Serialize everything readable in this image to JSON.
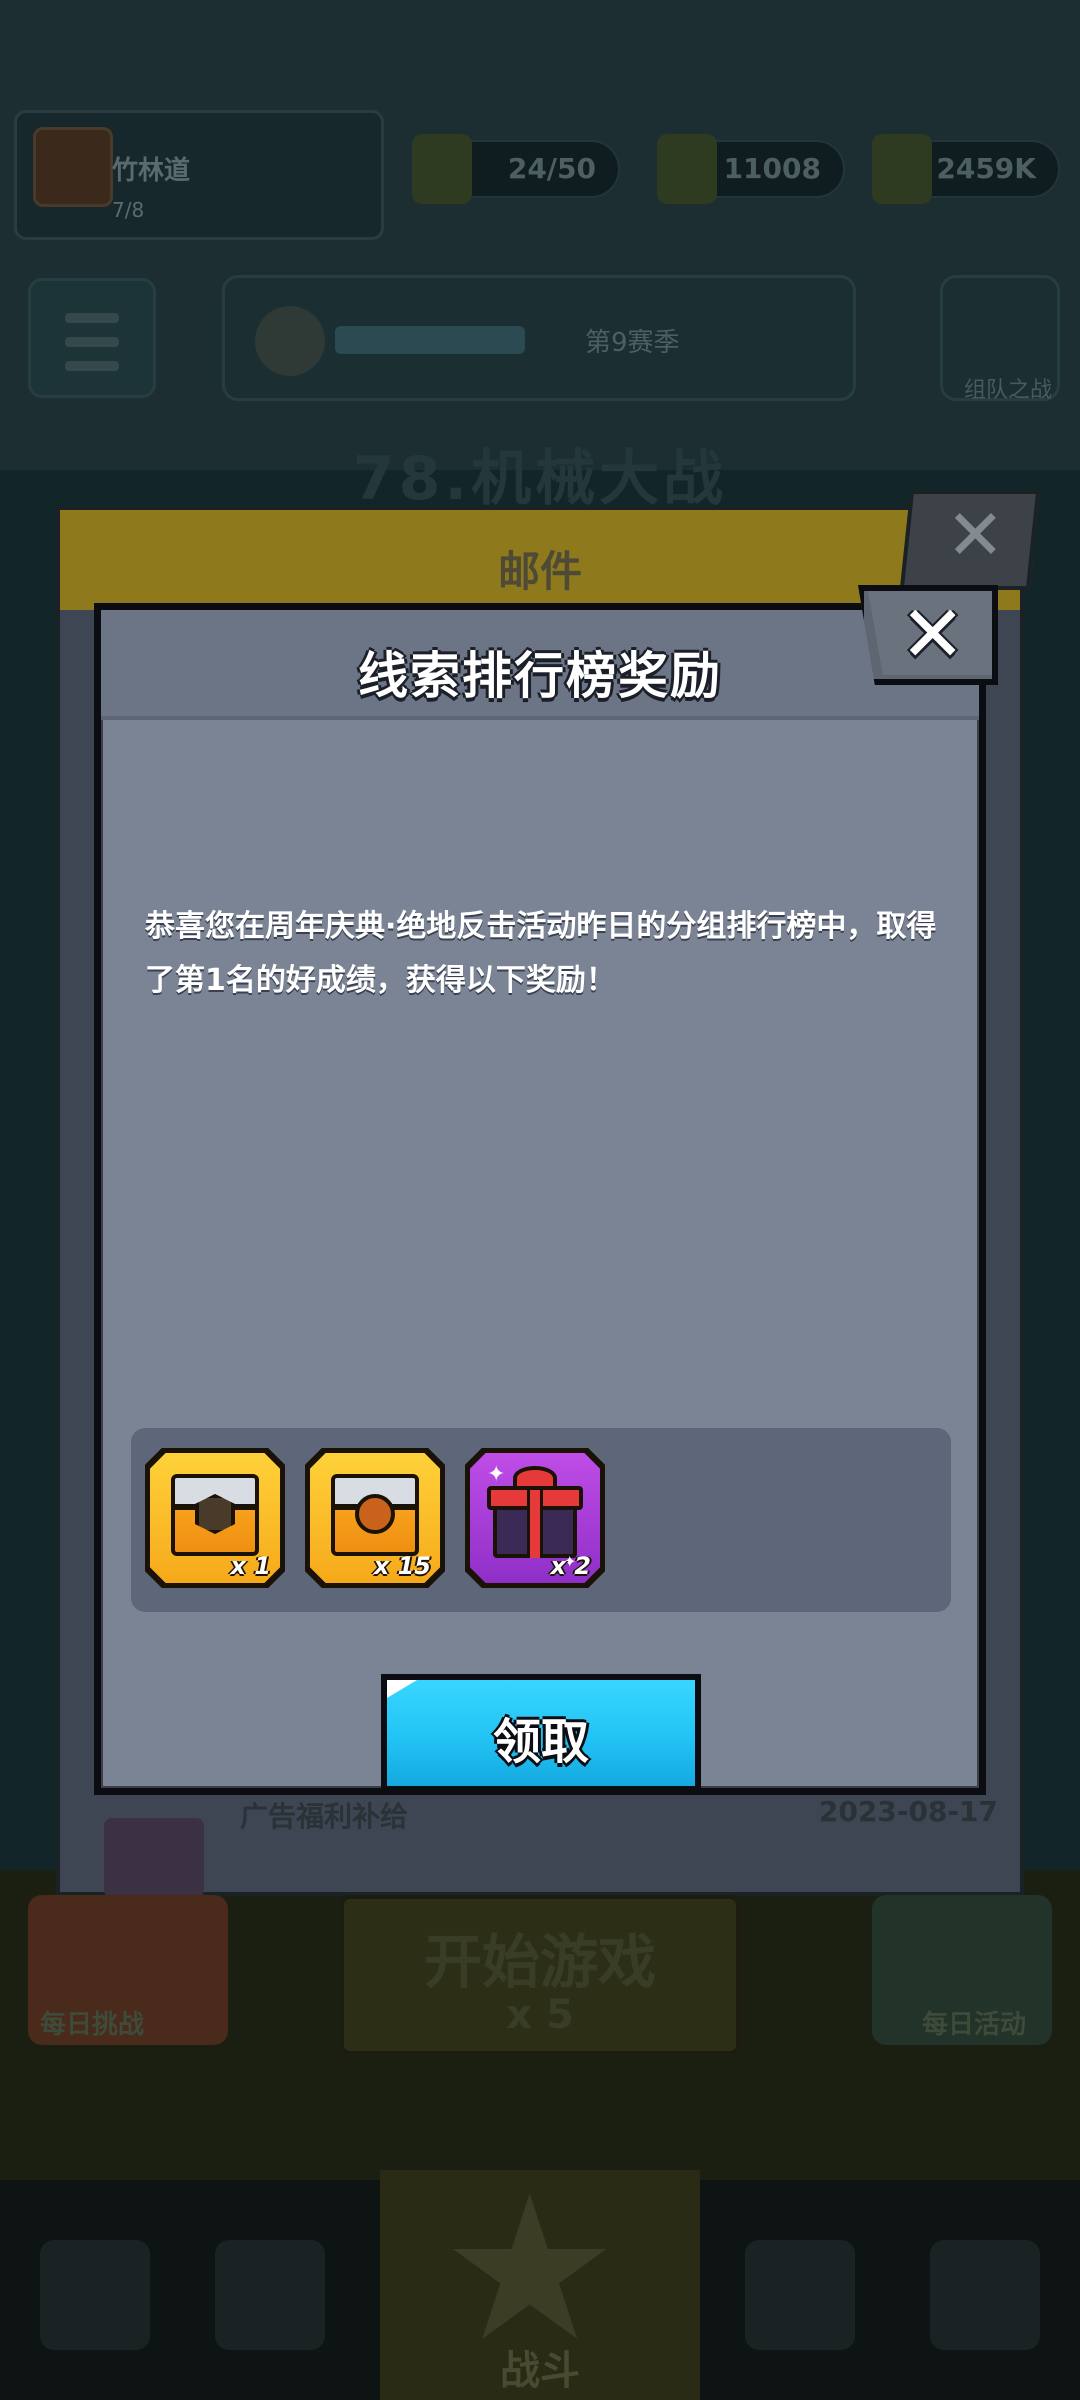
{
  "background": {
    "profile": {
      "name": "竹林道",
      "level": "7/8"
    },
    "resources": [
      {
        "icon": "energy-icon",
        "value": "24/50"
      },
      {
        "icon": "cash-icon",
        "value": "11008"
      },
      {
        "icon": "coin-icon",
        "value": "2459K"
      }
    ],
    "rank_text": "第9赛季",
    "shield_label": "组队之战",
    "title": "78.机械大战",
    "mail": {
      "title": "邮件",
      "item_label": "广告福利补给",
      "item_date": "2023-08-17"
    },
    "daily_label": "每日挑战",
    "start": {
      "label": "开始游戏",
      "sub": "x 5"
    },
    "event_label": "每日活动",
    "battle_label": "战斗"
  },
  "dialog": {
    "title": "线索排行榜奖励",
    "message": "恭喜您在周年庆典·绝地反击活动昨日的分组排行榜中，取得了第1名的好成绩，获得以下奖励！",
    "rewards": [
      {
        "icon": "gold-chest-icon",
        "qty": "x 1"
      },
      {
        "icon": "gold-chest-icon",
        "qty": "x 15"
      },
      {
        "icon": "gift-box-icon",
        "qty": "x 2"
      }
    ],
    "claim_label": "领取"
  }
}
